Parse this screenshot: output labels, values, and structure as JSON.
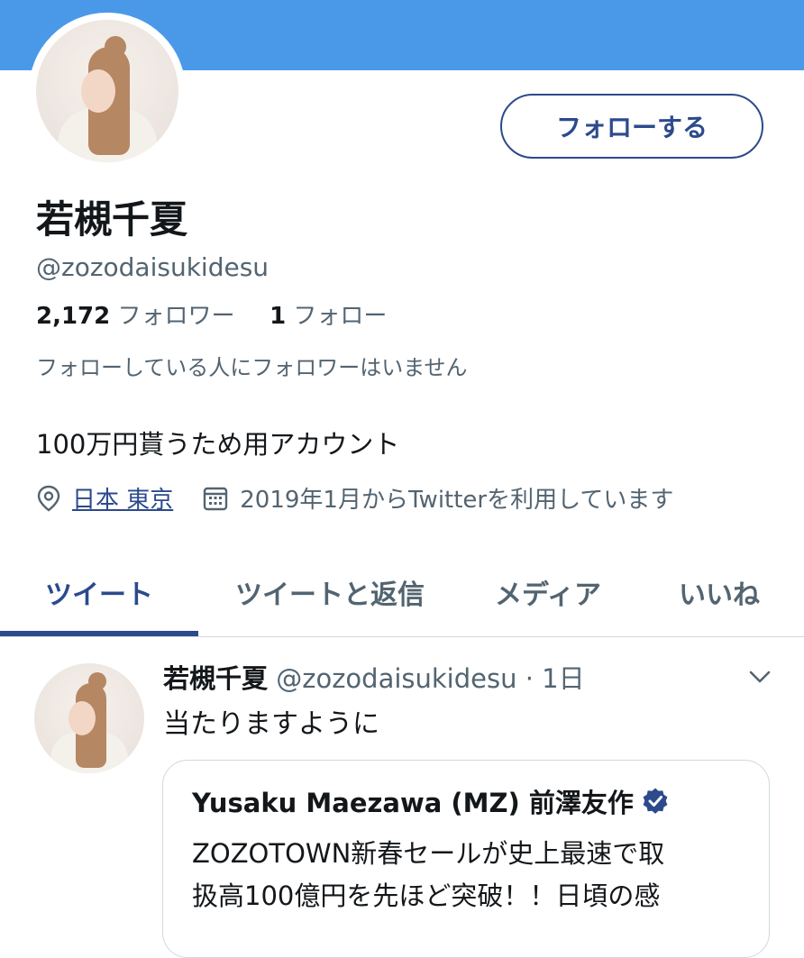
{
  "profile": {
    "follow_button": "フォローする",
    "name": "若槻千夏",
    "handle": "@zozodaisukidesu",
    "followers_count": "2,172",
    "followers_label": "フォロワー",
    "following_count": "1",
    "following_label": "フォロー",
    "followed_by_notice": "フォローしている人にフォロワーはいません",
    "bio": "100万円貰うため用アカウント",
    "location": "日本 東京",
    "joined": "2019年1月からTwitterを利用しています"
  },
  "tabs": [
    {
      "label": "ツイート",
      "active": true
    },
    {
      "label": "ツイートと返信",
      "active": false
    },
    {
      "label": "メディア",
      "active": false
    },
    {
      "label": "いいね",
      "active": false
    }
  ],
  "tweet": {
    "name": "若槻千夏",
    "handle": "@zozodaisukidesu",
    "time": "1日",
    "text": "当たりますように",
    "quote": {
      "name": "Yusaku Maezawa (MZ) 前澤友作",
      "verified": true,
      "text_line1": "ZOZOTOWN新春セールが史上最速で取",
      "text_line2": "扱高100億円を先ほど突破！！日頃の感"
    }
  },
  "colors": {
    "banner": "#4a99e9",
    "accent": "#2c4a8c",
    "verified": "#2c4a8c"
  },
  "icons": [
    "location-pin-icon",
    "calendar-icon",
    "chevron-down-icon",
    "verified-badge-icon"
  ]
}
